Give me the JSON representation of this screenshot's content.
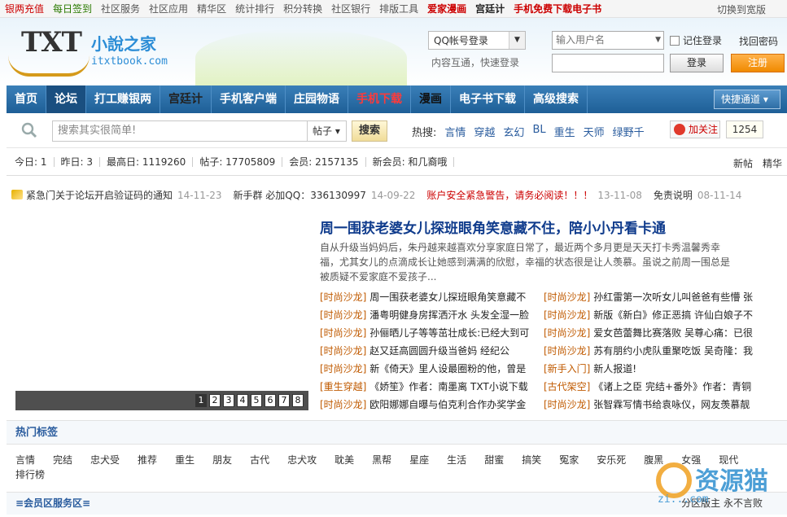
{
  "topbar": {
    "links": [
      {
        "label": "银两充值",
        "style": "c-red"
      },
      {
        "label": "每日签到",
        "style": "c-green"
      },
      {
        "label": "社区服务",
        "style": ""
      },
      {
        "label": "社区应用",
        "style": ""
      },
      {
        "label": "精华区",
        "style": ""
      },
      {
        "label": "统计排行",
        "style": ""
      },
      {
        "label": "积分转换",
        "style": ""
      },
      {
        "label": "社区银行",
        "style": ""
      },
      {
        "label": "排版工具",
        "style": ""
      },
      {
        "label": "爱家漫画",
        "style": "c-redb"
      },
      {
        "label": "宫廷计",
        "style": "c-bold"
      },
      {
        "label": "手机免费下载电子书",
        "style": "c-redb"
      }
    ],
    "switch_label": "切换到宽版"
  },
  "header": {
    "logo_text": "TXT",
    "logo_cn": "小說之家",
    "logo_domain": "itxtbook.com",
    "qq_login": "QQ帐号登录",
    "qq_sub": "内容互通，快速登录",
    "username_placeholder": "输入用户名",
    "remember_label": "记住登录",
    "find_password": "找回密码",
    "login_btn": "登录",
    "register_btn": "注册"
  },
  "nav": {
    "items": [
      {
        "label": "首页",
        "style": ""
      },
      {
        "label": "论坛",
        "style": "active"
      },
      {
        "label": "打工赚银两",
        "style": ""
      },
      {
        "label": "宫廷计",
        "style": "dark"
      },
      {
        "label": "手机客户端",
        "style": ""
      },
      {
        "label": "庄园物语",
        "style": ""
      },
      {
        "label": "手机下载",
        "style": "red"
      },
      {
        "label": "漫画",
        "style": "black2"
      },
      {
        "label": "电子书下载",
        "style": ""
      },
      {
        "label": "高级搜索",
        "style": ""
      }
    ],
    "quick_label": "快捷通道 ▾"
  },
  "search": {
    "placeholder": "搜索其实很简单!",
    "type": "帖子 ▾",
    "button": "搜索",
    "hot_label": "热搜:",
    "hot_words": [
      "言情",
      "穿越",
      "玄幻",
      "BL",
      "重生",
      "天师",
      "绿野千"
    ],
    "follow_label": "加关注",
    "follow_count": "1254"
  },
  "stats": {
    "items": [
      "今日: 1",
      "昨日: 3",
      "最高日: 1119260",
      "帖子: 17705809",
      "会员: 2157135",
      "新会员: 和几裔哦"
    ],
    "right": [
      "新帖",
      "精华"
    ]
  },
  "notice": {
    "items": [
      {
        "text": "紧急门关于论坛开启验证码的通知",
        "date": "14-11-23",
        "warn": false
      },
      {
        "text": "新手群 必加QQ：336130997",
        "date": "14-09-22",
        "warn": false
      },
      {
        "text": "账户安全紧急警告，请务必阅读！！！",
        "date": "13-11-08",
        "warn": true
      },
      {
        "text": "免责说明",
        "date": "08-11-14",
        "warn": false
      }
    ]
  },
  "slider": {
    "pages": [
      "1",
      "2",
      "3",
      "4",
      "5",
      "6",
      "7",
      "8"
    ]
  },
  "feature": {
    "headline": "周一围获老婆女儿探班眼角笑意藏不住，陪小小丹看卡通",
    "summary": "自从升级当妈妈后，朱丹越来越喜欢分享家庭日常了，最近两个多月更是天天打卡秀温馨秀幸福，尤其女儿的点滴成长让她感到满满的欣慰，幸福的状态很是让人羡慕。虽说之前周一围总是被质疑不爱家庭不爱孩子..."
  },
  "list_left": [
    {
      "tag": "[时尚沙龙]",
      "title": "周一围获老婆女儿探班眼角笑意藏不"
    },
    {
      "tag": "[时尚沙龙]",
      "title": "潘粤明健身房挥洒汗水 头发全湿一脸"
    },
    {
      "tag": "[时尚沙龙]",
      "title": "孙俪晒儿子等等茁壮成长:已经大到可"
    },
    {
      "tag": "[时尚沙龙]",
      "title": "赵又廷高圆圆升级当爸妈 经纪公"
    },
    {
      "tag": "[时尚沙龙]",
      "title": "新《倚天》里人设最圈粉的他，曾是"
    },
    {
      "tag": "[重生穿越]",
      "title": "《娇笙》作者：南墨离 TXT小说下载"
    },
    {
      "tag": "[时尚沙龙]",
      "title": "欧阳娜娜自曝与伯克利合作办奖学金"
    }
  ],
  "list_right": [
    {
      "tag": "[时尚沙龙]",
      "title": "孙红雷第一次听女儿叫爸爸有些懵 张"
    },
    {
      "tag": "[时尚沙龙]",
      "title": "新版《新白》修正恶搞 许仙白娘子不"
    },
    {
      "tag": "[时尚沙龙]",
      "title": "爱女芭蕾舞比赛落败 吴尊心痛：已很"
    },
    {
      "tag": "[时尚沙龙]",
      "title": "苏有朋约小虎队重聚吃饭 吴奇隆：我"
    },
    {
      "tag": "[新手入门]",
      "title": "新人报道!"
    },
    {
      "tag": "[古代架空]",
      "title": "《诸上之臣 完结+番外》作者：青铜"
    },
    {
      "tag": "[时尚沙龙]",
      "title": "张智霖写情书给袁咏仪，网友羡慕靓"
    }
  ],
  "tags": {
    "title": "热门标签",
    "items": [
      "言情",
      "完结",
      "忠犬受",
      "推荐",
      "重生",
      "朋友",
      "古代",
      "忠犬攻",
      "耽美",
      "黑帮",
      "星座",
      "生活",
      "甜蜜",
      "搞笑",
      "冤家",
      "安乐死",
      "腹黑",
      "女强",
      "现代",
      "排行榜"
    ]
  },
  "service": {
    "title": "≡会员区服务区≡",
    "right": "分区版主 永不言败"
  },
  "watermark": {
    "text": "资源猫",
    "url": "zi...com"
  }
}
